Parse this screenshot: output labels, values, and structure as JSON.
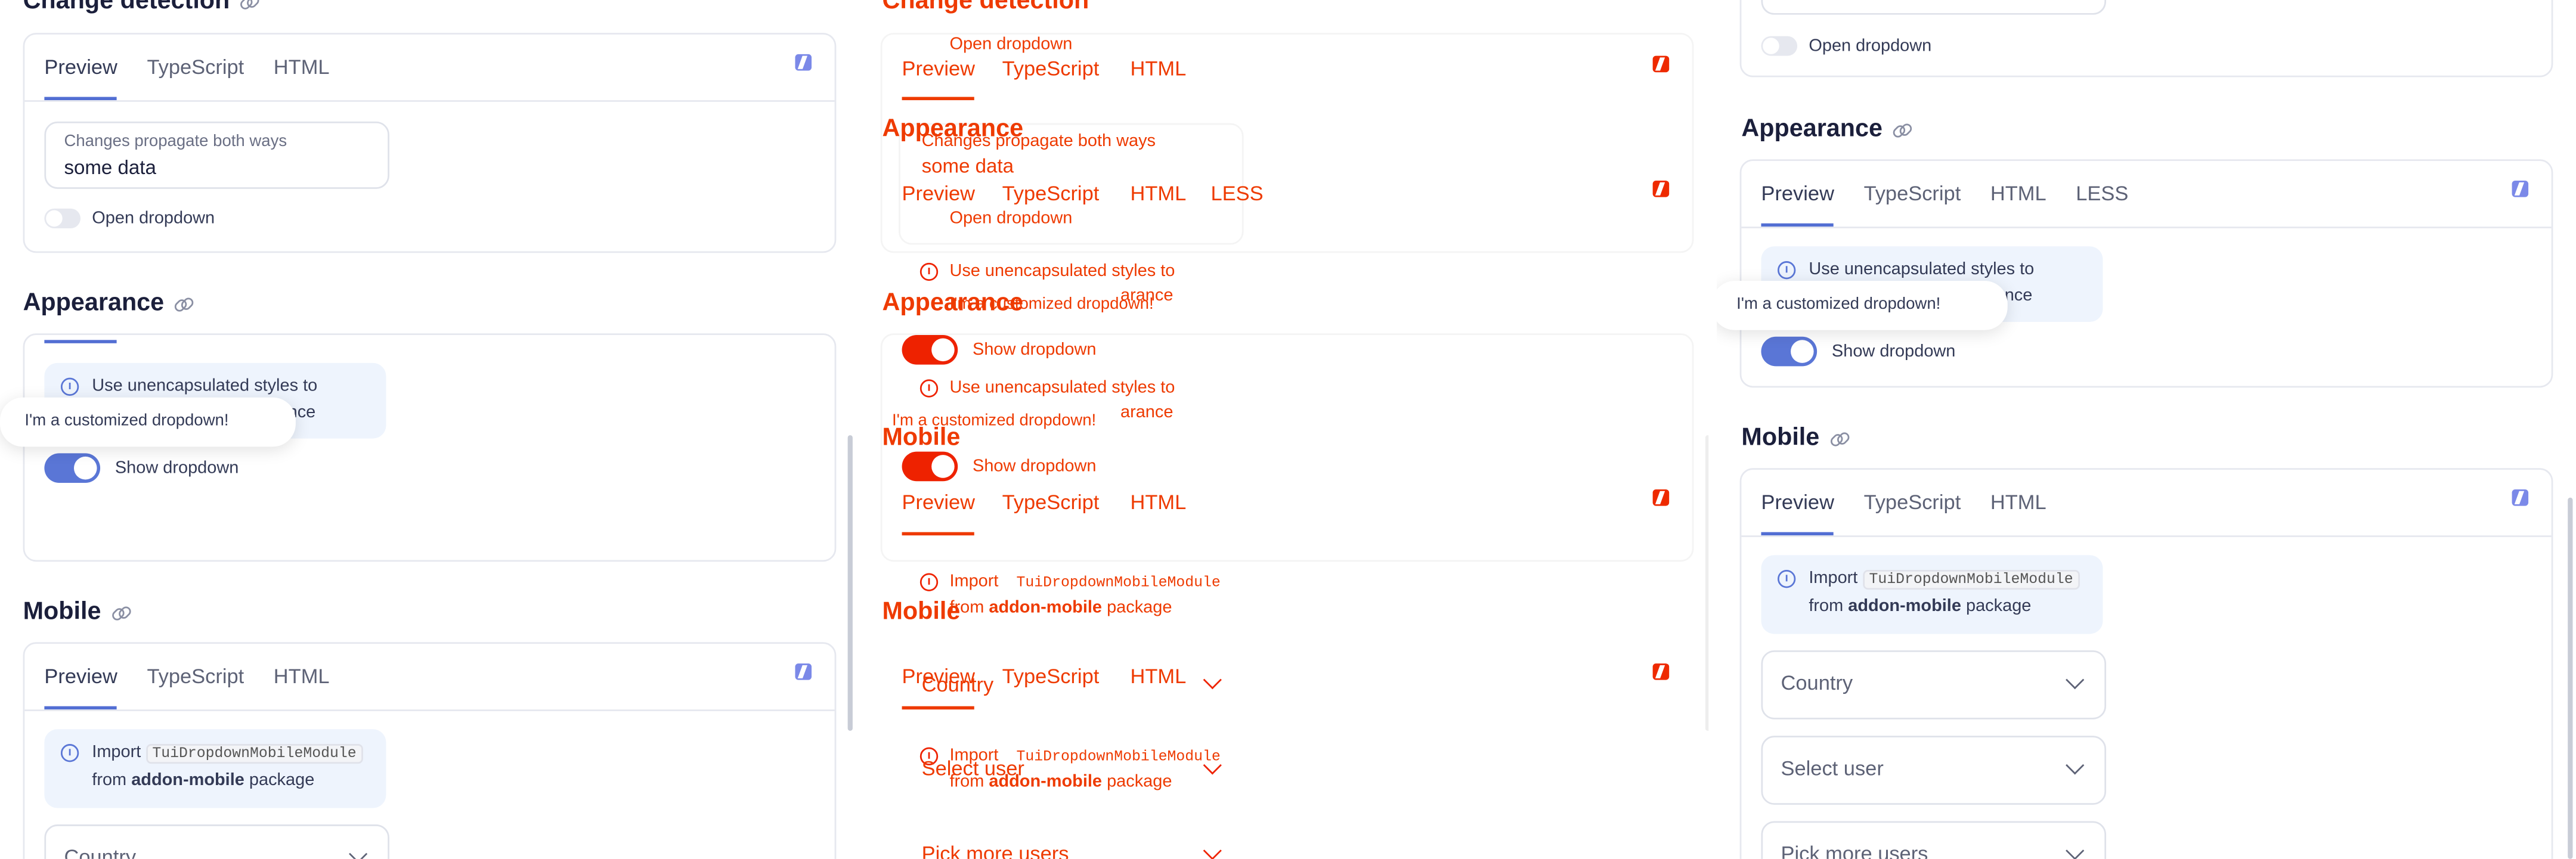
{
  "tabs": {
    "preview": "Preview",
    "typescript": "TypeScript",
    "html": "HTML",
    "less": "LESS"
  },
  "sections": {
    "change_detection": "Change detection",
    "appearance": "Appearance",
    "mobile": "Mobile"
  },
  "change_detection": {
    "field_label": "Changes propagate both ways",
    "field_value": "some data",
    "toggle_label": "Open dropdown"
  },
  "appearance": {
    "note_line1": "Use unencapsulated styles to",
    "note_line2_end": "arance",
    "popup": "I'm a customized dropdown!",
    "toggle_label": "Show dropdown"
  },
  "mobile": {
    "note_import": "Import",
    "note_module": "TuiDropdownMobileModule",
    "note_from": "from",
    "note_pkg": "addon-mobile",
    "note_package": "package",
    "country": "Country",
    "select_user": "Select user",
    "pick_more": "Pick more users"
  },
  "colors": {
    "accent": "#526ed3",
    "ghost": "#ee3a00",
    "note_bg": "#eef4fd"
  }
}
